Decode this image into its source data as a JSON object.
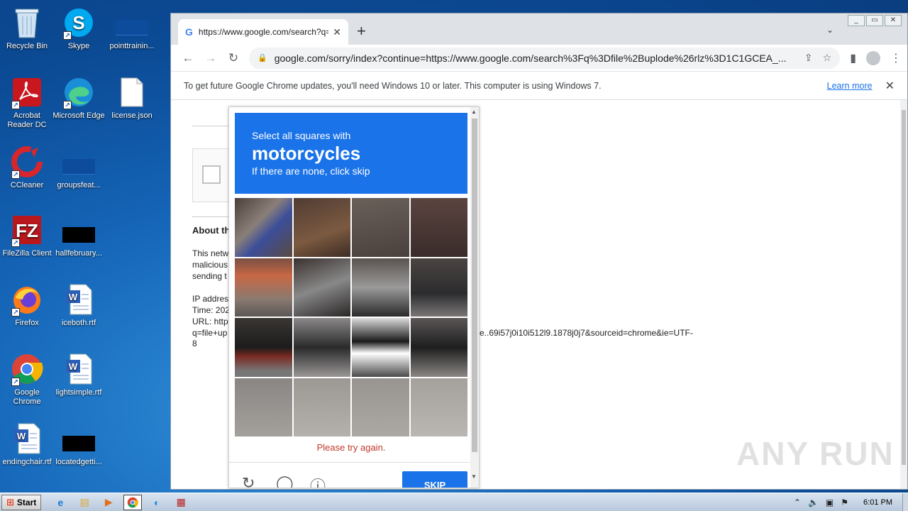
{
  "desktop": {
    "icons": [
      {
        "label": "Recycle Bin",
        "icon": "recycle-bin-icon"
      },
      {
        "label": "Skype",
        "icon": "skype-icon"
      },
      {
        "label": "pointtrainin...",
        "icon": "file-thumbnail-icon"
      },
      {
        "label": "Acrobat Reader DC",
        "icon": "acrobat-icon"
      },
      {
        "label": "Microsoft Edge",
        "icon": "edge-icon"
      },
      {
        "label": "license.json",
        "icon": "document-icon"
      },
      {
        "label": "CCleaner",
        "icon": "ccleaner-icon"
      },
      {
        "label": "groupsfeat...",
        "icon": "file-thumbnail-icon"
      },
      {
        "label": "FileZilla Client",
        "icon": "filezilla-icon"
      },
      {
        "label": "hallfebruary...",
        "icon": "file-thumbnail-icon"
      },
      {
        "label": "Firefox",
        "icon": "firefox-icon"
      },
      {
        "label": "iceboth.rtf",
        "icon": "word-doc-icon"
      },
      {
        "label": "Google Chrome",
        "icon": "chrome-icon"
      },
      {
        "label": "lightsimple.rtf",
        "icon": "word-doc-icon"
      },
      {
        "label": "endingchair.rtf",
        "icon": "word-doc-icon"
      },
      {
        "label": "locatedgetti...",
        "icon": "file-thumbnail-icon"
      }
    ]
  },
  "browser": {
    "tab_title": "https://www.google.com/search?q=",
    "new_tab": "+",
    "url": "google.com/sorry/index?continue=https://www.google.com/search%3Fq%3Dfile%2Buplode%26rlz%3D1C1GCEA_...",
    "infobar": {
      "message": "To get future Google Chrome updates, you'll need Windows 10 or later. This computer is using Windows 7.",
      "learn_more": "Learn more"
    }
  },
  "page": {
    "about_heading": "About th",
    "para_lines": [
      "This netw",
      "malicious",
      "sending t"
    ],
    "ip_lines": [
      "IP addres",
      "Time: 202",
      "URL: http",
      "q=file+up"
    ],
    "url_tail": "e..69i57j0i10i512l9.1878j0j7&sourceid=chrome&ie=UTF-",
    "url_end": "8"
  },
  "captcha": {
    "line1": "Select all squares with",
    "target": "motorcycles",
    "line3": "If there are none, click skip",
    "error": "Please try again.",
    "skip": "SKIP"
  },
  "watermark": "ANY RUN",
  "taskbar": {
    "start": "Start",
    "clock": "6:01 PM"
  }
}
